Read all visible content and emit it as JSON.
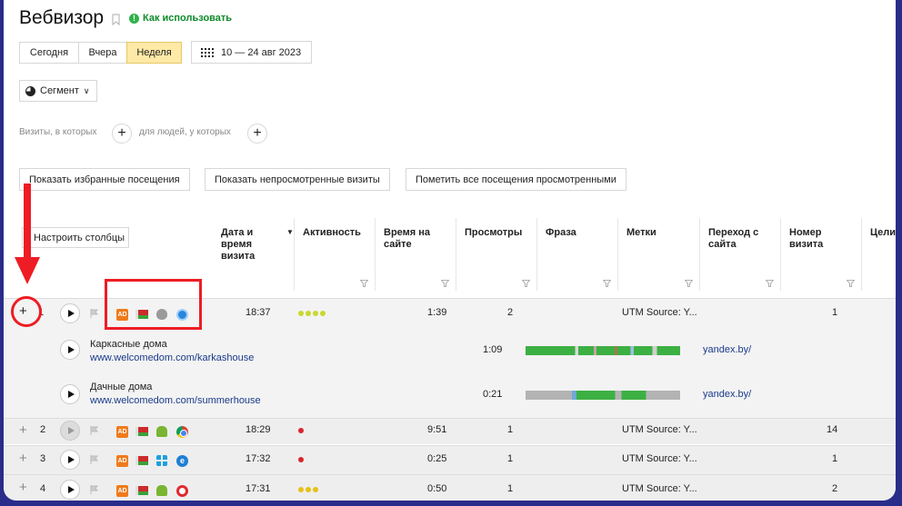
{
  "header": {
    "title": "Вебвизор",
    "howto_label": "Как использовать"
  },
  "period": {
    "buttons": [
      "Сегодня",
      "Вчера",
      "Неделя"
    ],
    "active": "Неделя",
    "date_range": "10 — 24 авг 2023"
  },
  "segment": {
    "label": "Сегмент"
  },
  "filters": {
    "visits_label": "Визиты, в которых",
    "people_label": "для людей, у которых"
  },
  "actions": {
    "favorites": "Показать избранные посещения",
    "unviewed": "Показать непросмотренные визиты",
    "mark_all": "Пометить все посещения просмотренными"
  },
  "table": {
    "columns_button": "Настроить столбцы",
    "headers": {
      "datetime": "Дата и время визита",
      "activity": "Активность",
      "time_on_site": "Время на сайте",
      "views": "Просмотры",
      "phrase": "Фраза",
      "tags": "Метки",
      "referral": "Переход с сайта",
      "visit_number": "Номер визита",
      "goals": "Цели"
    },
    "rows": [
      {
        "n": "1",
        "time": "18:37",
        "activity_dots": 4,
        "activity_color": "#c9d82e",
        "duration": "1:39",
        "views": "2",
        "tags": "UTM Source: Y...",
        "visit_no": "1",
        "icons": [
          "ad-icon",
          "belarus-flag-icon",
          "apple-icon",
          "safari-icon"
        ]
      },
      {
        "n": "2",
        "time": "18:29",
        "activity_dots": 1,
        "activity_color": "#d8262c",
        "duration": "9:51",
        "views": "1",
        "tags": "UTM Source: Y...",
        "visit_no": "14",
        "icons": [
          "ad-icon",
          "belarus-flag-icon",
          "android-icon",
          "chrome-icon"
        ]
      },
      {
        "n": "3",
        "time": "17:32",
        "activity_dots": 1,
        "activity_color": "#d8262c",
        "duration": "0:25",
        "views": "1",
        "tags": "UTM Source: Y...",
        "visit_no": "1",
        "icons": [
          "ad-icon",
          "belarus-flag-icon",
          "windows-icon",
          "edge-icon"
        ]
      },
      {
        "n": "4",
        "time": "17:31",
        "activity_dots": 3,
        "activity_color": "#e6c117",
        "duration": "0:50",
        "views": "1",
        "tags": "UTM Source: Y...",
        "visit_no": "2",
        "icons": [
          "ad-icon",
          "belarus-flag-icon",
          "android-icon",
          "opera-icon"
        ]
      }
    ],
    "pages": [
      {
        "title": "Каркасные дома",
        "url": "www.welcomedom.com/karkashouse",
        "duration": "1:09",
        "referrer": "yandex.by/"
      },
      {
        "title": "Дачные дома",
        "url": "www.welcomedom.com/summerhouse",
        "duration": "0:21",
        "referrer": "yandex.by/"
      }
    ]
  },
  "colors": {
    "accent_active": "#ffe9a6",
    "annotation_red": "#ee1c24",
    "link": "#1a3a8a",
    "howto_green": "#0d8a2a"
  }
}
